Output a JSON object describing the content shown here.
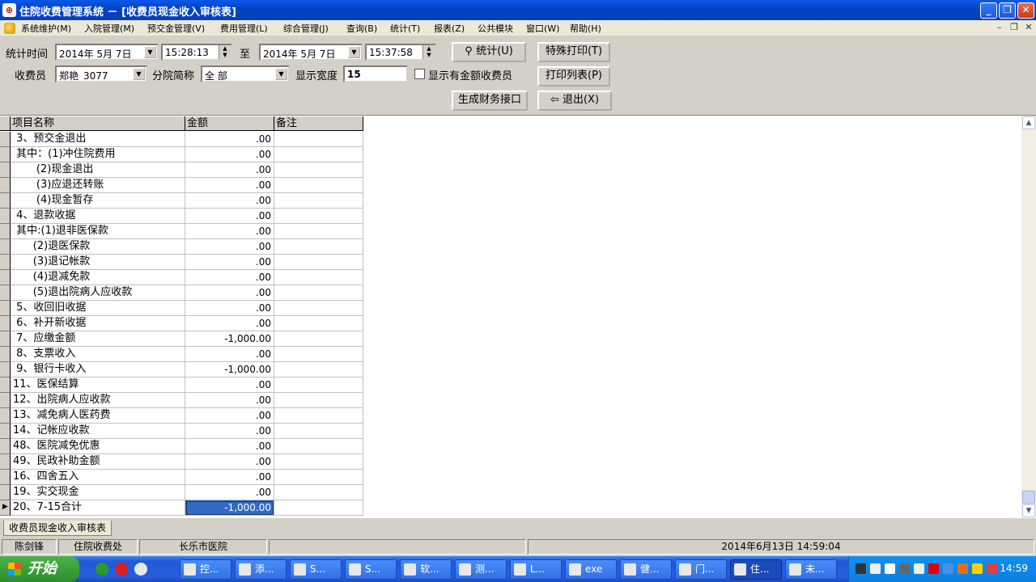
{
  "window": {
    "title": "住院收费管理系统 － [收费员现金收入审核表]",
    "app_icon": "hospital-icon"
  },
  "menu": [
    "系统维护(M)",
    "入院管理(M)",
    "预交金管理(V)",
    "费用管理(L)",
    "综合管理(J)",
    "查询(B)",
    "统计(T)",
    "报表(Z)",
    "公共模块",
    "窗口(W)",
    "帮助(H)"
  ],
  "filters": {
    "time_label": "统计时间",
    "start_date": "2014年 5月 7日",
    "start_time": "15:28:13",
    "to_label": "至",
    "end_date": "2014年 5月 7日",
    "end_time": "15:37:58",
    "cashier_label": "收费员",
    "cashier": "郑艳_3077",
    "branch_label": "分院简称",
    "branch": "全 部",
    "width_label": "显示宽度",
    "width": "15",
    "show_cashier_label": "显示有金额收费员"
  },
  "buttons": {
    "stat": "统计(U)",
    "special_print": "特殊打印(T)",
    "print_list": "打印列表(P)",
    "finance": "生成财务接口",
    "exit": "退出(X)"
  },
  "grid": {
    "columns": [
      "项目名称",
      "金额",
      "备注"
    ],
    "rows": [
      {
        "name": " 3、预交金退出",
        "amount": ".00",
        "note": ""
      },
      {
        "name": " 其中：(1)冲住院费用",
        "amount": ".00",
        "note": ""
      },
      {
        "name": "       (2)现金退出",
        "amount": ".00",
        "note": ""
      },
      {
        "name": "       (3)应退还转账",
        "amount": ".00",
        "note": ""
      },
      {
        "name": "       (4)现金暂存",
        "amount": ".00",
        "note": ""
      },
      {
        "name": " 4、退款收据",
        "amount": ".00",
        "note": ""
      },
      {
        "name": " 其中:(1)退非医保款",
        "amount": ".00",
        "note": ""
      },
      {
        "name": "      (2)退医保款",
        "amount": ".00",
        "note": ""
      },
      {
        "name": "      (3)退记帐款",
        "amount": ".00",
        "note": ""
      },
      {
        "name": "      (4)退减免款",
        "amount": ".00",
        "note": ""
      },
      {
        "name": "      (5)退出院病人应收款",
        "amount": ".00",
        "note": ""
      },
      {
        "name": " 5、收回旧收据",
        "amount": ".00",
        "note": ""
      },
      {
        "name": " 6、补开新收据",
        "amount": ".00",
        "note": ""
      },
      {
        "name": " 7、应缴金额",
        "amount": "-1,000.00",
        "note": ""
      },
      {
        "name": " 8、支票收入",
        "amount": ".00",
        "note": ""
      },
      {
        "name": " 9、银行卡收入",
        "amount": "-1,000.00",
        "note": ""
      },
      {
        "name": "11、医保结算",
        "amount": ".00",
        "note": ""
      },
      {
        "name": "12、出院病人应收款",
        "amount": ".00",
        "note": ""
      },
      {
        "name": "13、减免病人医药费",
        "amount": ".00",
        "note": ""
      },
      {
        "name": "14、记帐应收款",
        "amount": ".00",
        "note": ""
      },
      {
        "name": "48、医院减免优惠",
        "amount": ".00",
        "note": ""
      },
      {
        "name": "49、民政补助金额",
        "amount": ".00",
        "note": ""
      },
      {
        "name": "16、四舍五入",
        "amount": ".00",
        "note": ""
      },
      {
        "name": "19、实交现金",
        "amount": ".00",
        "note": ""
      },
      {
        "name": "20、7-15合计",
        "amount": "-1,000.00",
        "note": "",
        "selected": true
      }
    ]
  },
  "tab": "收费员现金收入审核表",
  "status": {
    "user": "陈剑锋",
    "dept": "住院收费处",
    "hospital": "长乐市医院",
    "blank": "",
    "datetime": "2014年6月13日  14:59:04"
  },
  "taskbar": {
    "start": "开始",
    "tasks": [
      "控...",
      "添...",
      "S...",
      "S...",
      "软...",
      "测...",
      "L...",
      "exe",
      "健...",
      "门...",
      "住...",
      "未..."
    ],
    "active_index": 10,
    "clock": "14:59"
  }
}
